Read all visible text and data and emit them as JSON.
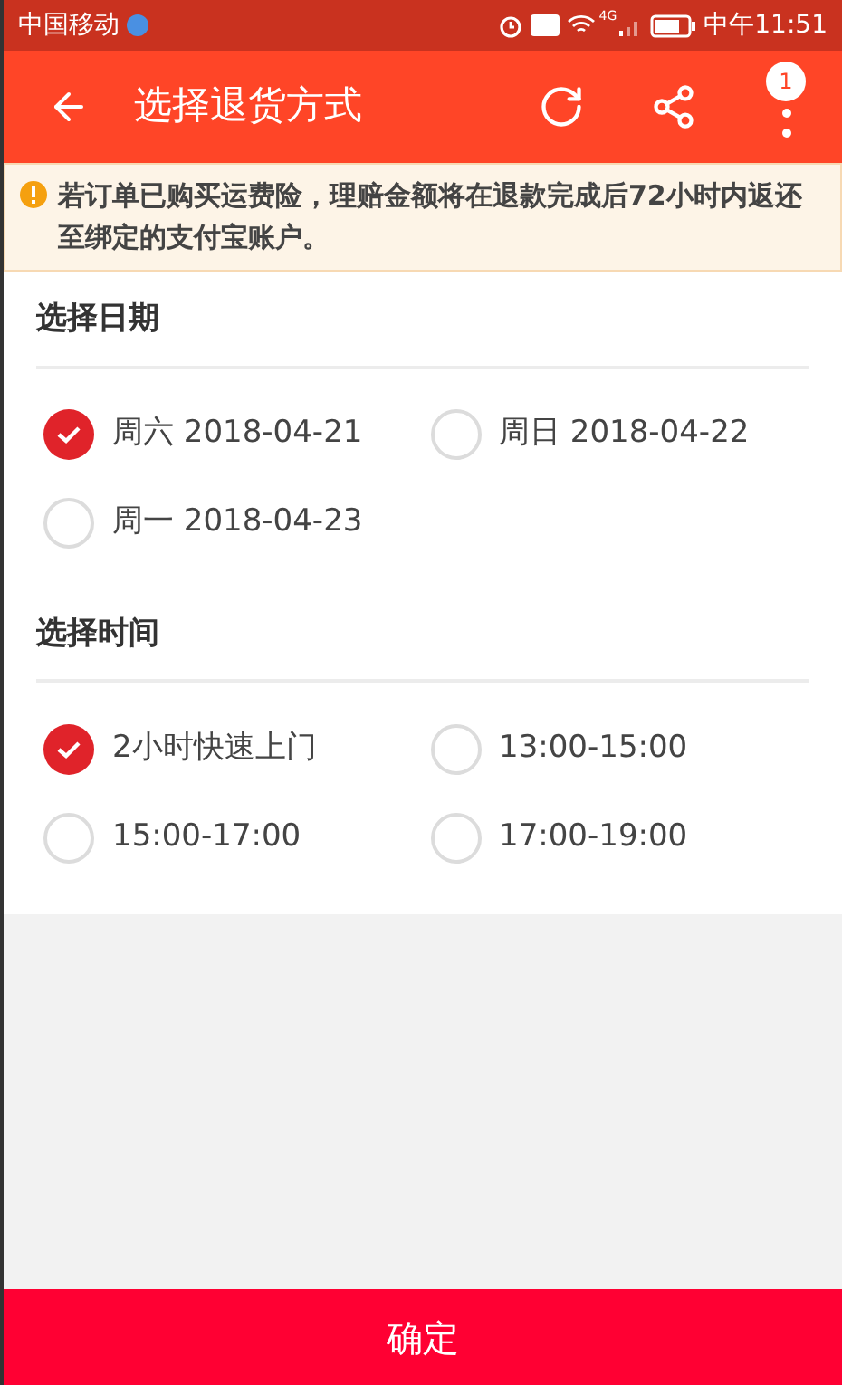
{
  "status_bar": {
    "carrier": "中国移动",
    "time": "中午11:51",
    "network": "4G"
  },
  "app_bar": {
    "title": "选择退货方式",
    "badge": "1"
  },
  "notice": {
    "text": "若订单已购买运费险，理赔金额将在退款完成后72小时内返还至绑定的支付宝账户。"
  },
  "sections": [
    {
      "title": "选择日期",
      "options": [
        {
          "label": "周六 2018-04-21",
          "selected": true
        },
        {
          "label": "周日 2018-04-22",
          "selected": false
        },
        {
          "label": "周一 2018-04-23",
          "selected": false
        }
      ]
    },
    {
      "title": "选择时间",
      "options": [
        {
          "label": "2小时快速上门",
          "selected": true
        },
        {
          "label": "13:00-15:00",
          "selected": false
        },
        {
          "label": "15:00-17:00",
          "selected": false
        },
        {
          "label": "17:00-19:00",
          "selected": false
        }
      ]
    }
  ],
  "confirm_button": "确定"
}
